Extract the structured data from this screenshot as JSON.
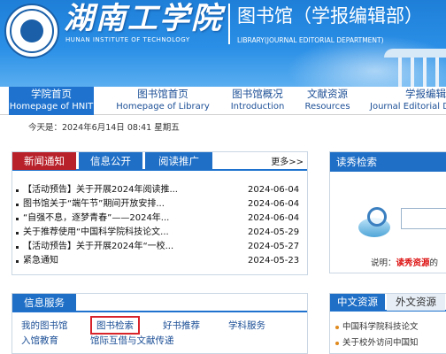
{
  "banner": {
    "school_name_cn": "湖南工学院",
    "school_name_en": "HUNAN INSTITUTE OF TECHNOLOGY",
    "library_title": "图书馆（学报编辑部）",
    "library_subtitle": "LIBRARY(JOURNAL EDITORIAL DEPARTMENT)",
    "colors": {
      "banner_blue": "#2a8fe6",
      "nav_active": "#1f73cf"
    }
  },
  "nav": {
    "items": [
      {
        "cn": "学院首页",
        "en": "Homepage of HNIT",
        "active": true
      },
      {
        "cn": "图书馆首页",
        "en": "Homepage of Library",
        "active": false
      },
      {
        "cn": "图书馆概况",
        "en": "Introduction",
        "active": false
      },
      {
        "cn": "文献资源",
        "en": "Resources",
        "active": false
      },
      {
        "cn": "学报编辑",
        "en": "Journal Editorial D",
        "active": false
      }
    ]
  },
  "datebar": {
    "text": "今天是：2024年6月14日 08:41 星期五"
  },
  "news": {
    "tabs": [
      {
        "label": "新闻通知",
        "active": true
      },
      {
        "label": "信息公开",
        "active": false
      },
      {
        "label": "阅读推广",
        "active": false
      }
    ],
    "more_label": "更多>>",
    "items": [
      {
        "title": "【活动预告】关于开展2024年阅读推...",
        "date": "2024-06-04"
      },
      {
        "title": "图书馆关于“端午节”期间开放安排...",
        "date": "2024-06-04"
      },
      {
        "title": "“自强不息，逐梦青春”——2024年...",
        "date": "2024-06-04"
      },
      {
        "title": "关于推荐使用“中国科学院科技论文...",
        "date": "2024-05-29"
      },
      {
        "title": "【活动预告】关于开展2024年“一校...",
        "date": "2024-05-27"
      },
      {
        "title": "紧急通知",
        "date": "2024-05-23"
      }
    ]
  },
  "duxiu": {
    "title": "读秀检索",
    "note_label": "说明：",
    "note_highlight": "读秀资源",
    "note_tail": "的"
  },
  "services": {
    "title": "信息服务",
    "links": [
      {
        "label": "我的图书馆",
        "highlighted": false
      },
      {
        "label": "图书检索",
        "highlighted": true
      },
      {
        "label": "好书推荐",
        "highlighted": false
      },
      {
        "label": "学科服务",
        "highlighted": false
      },
      {
        "label": "入馆教育",
        "highlighted": false
      },
      {
        "label": "馆际互借与文献传递",
        "highlighted": false
      }
    ],
    "highlight_color": "#d9232a"
  },
  "resources": {
    "tabs": [
      {
        "label": "中文资源",
        "active": true
      },
      {
        "label": "外文资源",
        "active": false
      }
    ],
    "items": [
      {
        "title": "中国科学院科技论文"
      },
      {
        "title": "关于校外访问中国知"
      }
    ]
  }
}
